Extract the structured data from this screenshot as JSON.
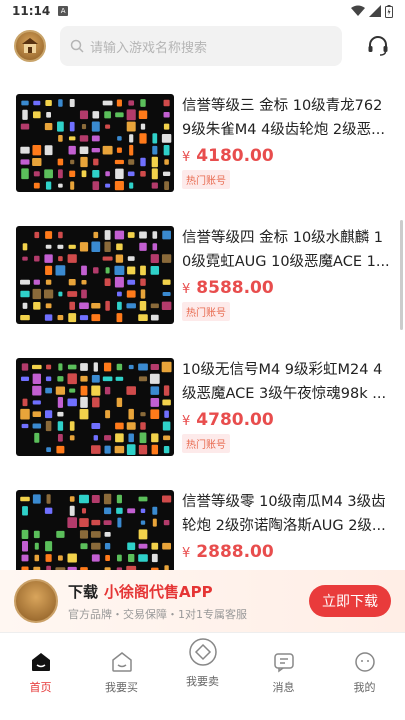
{
  "status": {
    "time": "11:14",
    "icon_a": "A"
  },
  "search": {
    "placeholder": "请输入游戏名称搜索"
  },
  "items": [
    {
      "title": "信誉等级三 金标 10级青龙7629级朱雀M4 4级齿轮炮 2级恶...",
      "currency": "¥",
      "price": "4180.00",
      "tag": "热门账号"
    },
    {
      "title": "信誉等级四 金标 10级水麒麟 10级霓虹AUG 10级恶魔ACE 1...",
      "currency": "¥",
      "price": "8588.00",
      "tag": "热门账号"
    },
    {
      "title": "10级无信号M4 9级彩虹M24 4级恶魔ACE 3级午夜惊魂98k ...",
      "currency": "¥",
      "price": "4780.00",
      "tag": "热门账号"
    },
    {
      "title": "信誉等级零 10级南瓜M4 3级齿轮炮 2级弥诺陶洛斯AUG 2级...",
      "currency": "¥",
      "price": "2888.00",
      "tag": ""
    }
  ],
  "promo": {
    "download": "下载",
    "brand": "小徐阁代售APP",
    "subtitle": "官方品牌・交易保障・1对1专属客服",
    "button": "立即下载"
  },
  "tabs": [
    {
      "label": "首页",
      "icon": "home-icon",
      "active": true
    },
    {
      "label": "我要买",
      "icon": "buy-icon",
      "active": false
    },
    {
      "label": "我要卖",
      "icon": "sell-icon",
      "active": false
    },
    {
      "label": "消息",
      "icon": "message-icon",
      "active": false
    },
    {
      "label": "我的",
      "icon": "profile-icon",
      "active": false
    }
  ],
  "colors": {
    "accent": "#e53535",
    "price": "#e84d4d",
    "tag_bg": "#fdeaea",
    "tag_text": "#e86a4f"
  }
}
